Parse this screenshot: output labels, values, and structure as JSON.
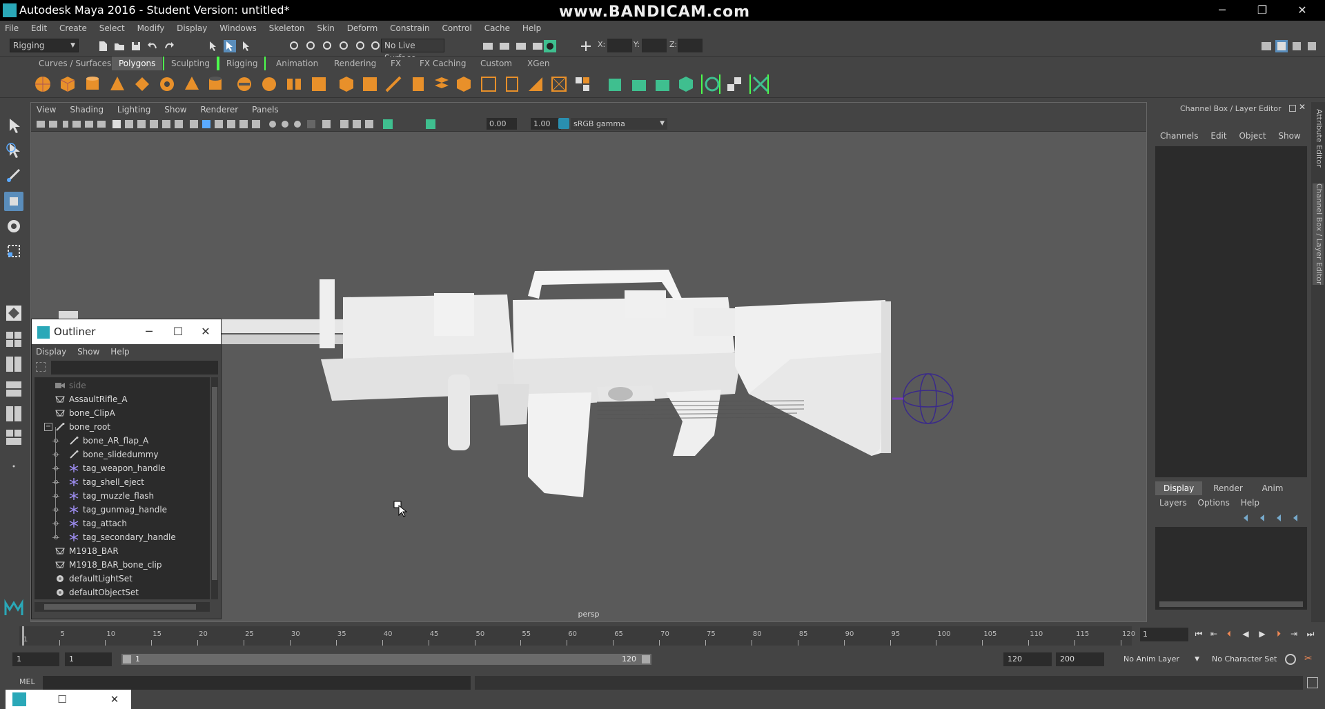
{
  "window": {
    "title": "Autodesk Maya 2016 - Student Version: untitled*",
    "watermark": "www.BANDICAM.com",
    "minimize": "─",
    "maximize": "❐",
    "close": "✕"
  },
  "menubar": [
    "File",
    "Edit",
    "Create",
    "Select",
    "Modify",
    "Display",
    "Windows",
    "Skeleton",
    "Skin",
    "Deform",
    "Constrain",
    "Control",
    "Cache",
    "Help"
  ],
  "statusline": {
    "menu_set": "Rigging",
    "live_surface": "No Live Surface",
    "x_label": "X:",
    "y_label": "Y:",
    "z_label": "Z:"
  },
  "shelf_tabs": [
    "Curves / Surfaces",
    "Polygons",
    "Sculpting",
    "Rigging",
    "Animation",
    "Rendering",
    "FX",
    "FX Caching",
    "Custom",
    "XGen"
  ],
  "viewport": {
    "menu": [
      "View",
      "Shading",
      "Lighting",
      "Show",
      "Renderer",
      "Panels"
    ],
    "exposure": "0.00",
    "gamma": "1.00",
    "color_space": "sRGB gamma",
    "camera": "persp"
  },
  "outliner": {
    "title": "Outliner",
    "menu": [
      "Display",
      "Show",
      "Help"
    ],
    "items": [
      {
        "label": "side",
        "type": "camera",
        "indent": 0,
        "dim": true
      },
      {
        "label": "AssaultRifle_A",
        "type": "mesh",
        "indent": 0
      },
      {
        "label": "bone_ClipA",
        "type": "mesh",
        "indent": 0
      },
      {
        "label": "bone_root",
        "type": "joint",
        "indent": 0,
        "expanded": true
      },
      {
        "label": "bone_AR_flap_A",
        "type": "joint",
        "indent": 1
      },
      {
        "label": "bone_slidedummy",
        "type": "joint",
        "indent": 1
      },
      {
        "label": "tag_weapon_handle",
        "type": "tag",
        "indent": 1
      },
      {
        "label": "tag_shell_eject",
        "type": "tag",
        "indent": 1
      },
      {
        "label": "tag_muzzle_flash",
        "type": "tag",
        "indent": 1
      },
      {
        "label": "tag_gunmag_handle",
        "type": "tag",
        "indent": 1
      },
      {
        "label": "tag_attach",
        "type": "tag",
        "indent": 1
      },
      {
        "label": "tag_secondary_handle",
        "type": "tag",
        "indent": 1
      },
      {
        "label": "M1918_BAR",
        "type": "mesh",
        "indent": 0
      },
      {
        "label": "M1918_BAR_bone_clip",
        "type": "mesh",
        "indent": 0
      },
      {
        "label": "defaultLightSet",
        "type": "set",
        "indent": 0
      },
      {
        "label": "defaultObjectSet",
        "type": "set",
        "indent": 0
      }
    ]
  },
  "channel_box": {
    "title": "Channel Box / Layer Editor",
    "menu": [
      "Channels",
      "Edit",
      "Object",
      "Show"
    ],
    "layer_tabs": [
      "Display",
      "Render",
      "Anim"
    ],
    "layer_menu": [
      "Layers",
      "Options",
      "Help"
    ],
    "side_tab_attribute": "Attribute Editor",
    "side_tab_channel": "Channel Box / Layer Editor"
  },
  "timeline": {
    "ticks": [
      "1",
      "5",
      "10",
      "15",
      "20",
      "25",
      "30",
      "35",
      "40",
      "45",
      "50",
      "55",
      "60",
      "65",
      "70",
      "75",
      "80",
      "85",
      "90",
      "95",
      "100",
      "105",
      "110",
      "115",
      "120"
    ],
    "current_frame": "1"
  },
  "range": {
    "start": "1",
    "playback_start": "1",
    "bar_start": "1",
    "bar_end": "120",
    "playback_end": "120",
    "end": "200",
    "anim_layer": "No Anim Layer",
    "character_set": "No Character Set"
  },
  "command_line": {
    "mode": "MEL"
  },
  "colors": {
    "accent": "#5a8dbb",
    "shelf_orange": "#e8902a",
    "shelf_green": "#3fbf8f",
    "tag_purple": "#9d8cf0",
    "bracket_green": "#4dff4d"
  }
}
